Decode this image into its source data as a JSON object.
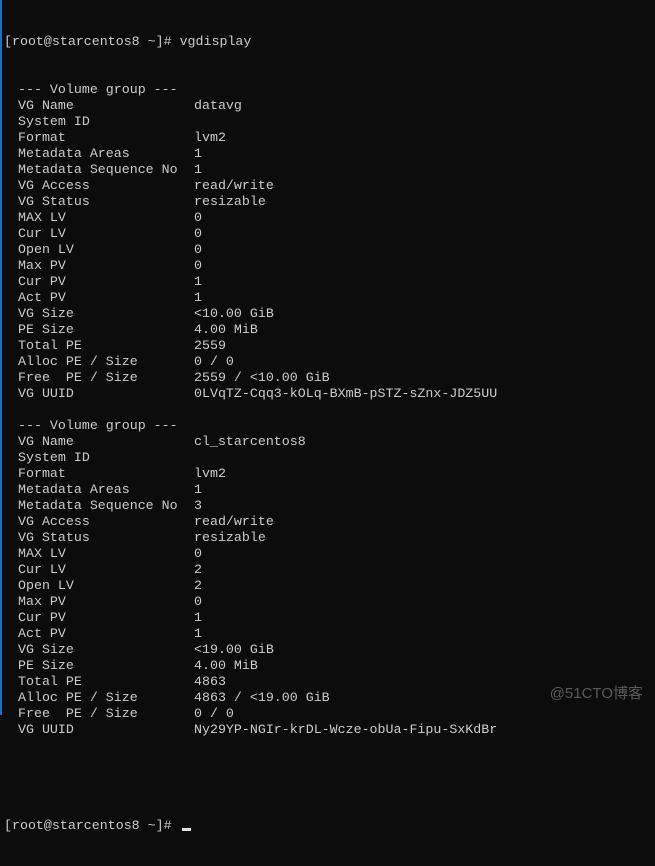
{
  "terminal": {
    "command_prompt": "[root@starcentos8 ~]# ",
    "command": "vgdisplay",
    "final_prompt": "[root@starcentos8 ~]# ",
    "watermark": "@51CTO博客",
    "volume_groups": [
      {
        "header": "--- Volume group ---",
        "fields": [
          {
            "label": "VG Name",
            "value": "datavg"
          },
          {
            "label": "System ID",
            "value": ""
          },
          {
            "label": "Format",
            "value": "lvm2"
          },
          {
            "label": "Metadata Areas",
            "value": "1"
          },
          {
            "label": "Metadata Sequence No",
            "value": "1"
          },
          {
            "label": "VG Access",
            "value": "read/write"
          },
          {
            "label": "VG Status",
            "value": "resizable"
          },
          {
            "label": "MAX LV",
            "value": "0"
          },
          {
            "label": "Cur LV",
            "value": "0"
          },
          {
            "label": "Open LV",
            "value": "0"
          },
          {
            "label": "Max PV",
            "value": "0"
          },
          {
            "label": "Cur PV",
            "value": "1"
          },
          {
            "label": "Act PV",
            "value": "1"
          },
          {
            "label": "VG Size",
            "value": "<10.00 GiB"
          },
          {
            "label": "PE Size",
            "value": "4.00 MiB"
          },
          {
            "label": "Total PE",
            "value": "2559"
          },
          {
            "label": "Alloc PE / Size",
            "value": "0 / 0"
          },
          {
            "label": "Free  PE / Size",
            "value": "2559 / <10.00 GiB"
          },
          {
            "label": "VG UUID",
            "value": "0LVqTZ-Cqq3-kOLq-BXmB-pSTZ-sZnx-JDZ5UU"
          }
        ]
      },
      {
        "header": "--- Volume group ---",
        "fields": [
          {
            "label": "VG Name",
            "value": "cl_starcentos8"
          },
          {
            "label": "System ID",
            "value": ""
          },
          {
            "label": "Format",
            "value": "lvm2"
          },
          {
            "label": "Metadata Areas",
            "value": "1"
          },
          {
            "label": "Metadata Sequence No",
            "value": "3"
          },
          {
            "label": "VG Access",
            "value": "read/write"
          },
          {
            "label": "VG Status",
            "value": "resizable"
          },
          {
            "label": "MAX LV",
            "value": "0"
          },
          {
            "label": "Cur LV",
            "value": "2"
          },
          {
            "label": "Open LV",
            "value": "2"
          },
          {
            "label": "Max PV",
            "value": "0"
          },
          {
            "label": "Cur PV",
            "value": "1"
          },
          {
            "label": "Act PV",
            "value": "1"
          },
          {
            "label": "VG Size",
            "value": "<19.00 GiB"
          },
          {
            "label": "PE Size",
            "value": "4.00 MiB"
          },
          {
            "label": "Total PE",
            "value": "4863"
          },
          {
            "label": "Alloc PE / Size",
            "value": "4863 / <19.00 GiB"
          },
          {
            "label": "Free  PE / Size",
            "value": "0 / 0"
          },
          {
            "label": "VG UUID",
            "value": "Ny29YP-NGIr-krDL-Wcze-obUa-Fipu-SxKdBr"
          }
        ]
      }
    ]
  }
}
